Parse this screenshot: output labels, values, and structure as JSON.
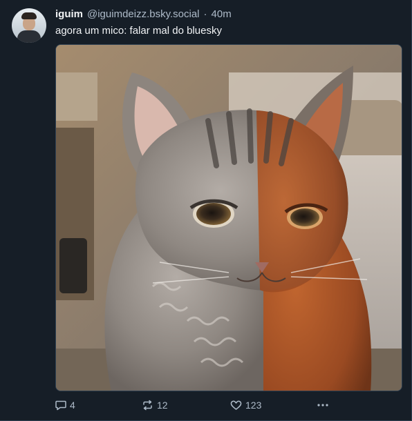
{
  "post": {
    "display_name": "iguim",
    "handle": "@iguimdeizz.bsky.social",
    "separator": "·",
    "time": "40m",
    "text": "agora um mico: falar mal do bluesky"
  },
  "actions": {
    "reply_count": "4",
    "repost_count": "12",
    "like_count": "123",
    "more_label": "..."
  },
  "icons": {
    "reply": "speech-bubble-icon",
    "repost": "repost-arrows-icon",
    "like": "heart-icon",
    "more": "ellipsis-icon"
  },
  "colors": {
    "background": "#161e27",
    "text": "#f1f3f5",
    "muted": "#aebbc9",
    "border": "#2e4052"
  }
}
